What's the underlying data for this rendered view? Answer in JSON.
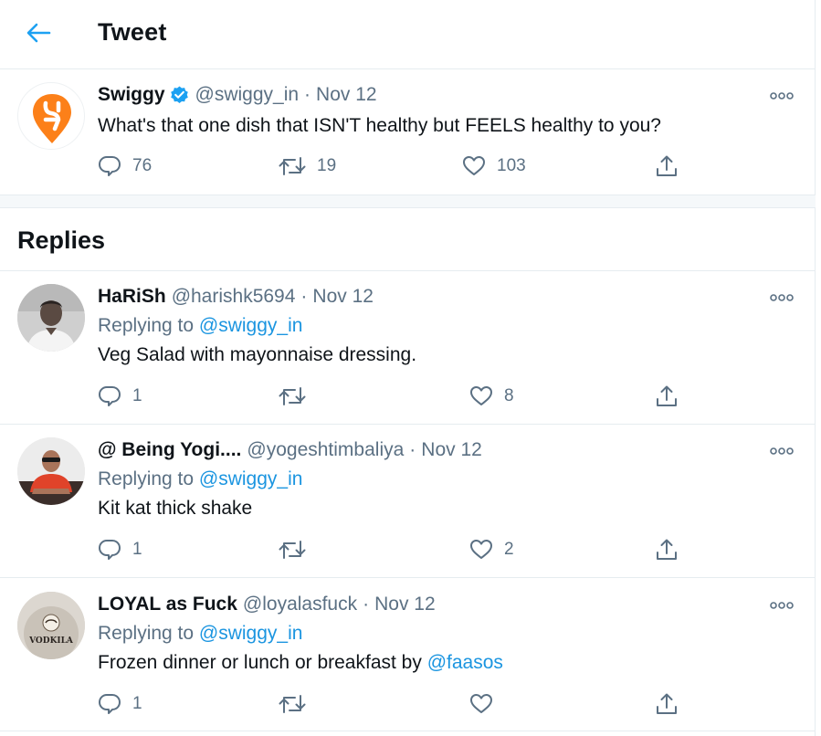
{
  "header": {
    "title": "Tweet",
    "back_icon": "arrow-left-icon"
  },
  "main_tweet": {
    "name": "Swiggy",
    "verified": true,
    "handle": "@swiggy_in",
    "separator": "·",
    "date": "Nov 12",
    "text": "What's that one dish that ISN'T healthy but FEELS healthy to you?",
    "replies": "76",
    "retweets": "19",
    "likes": "103",
    "brand_color": "#fc8019"
  },
  "replies_section": {
    "title": "Replies"
  },
  "replies": [
    {
      "name": "HaRiSh",
      "handle": "@harishk5694",
      "separator": "·",
      "date": "Nov 12",
      "replying_label": "Replying to",
      "replying_to": "@swiggy_in",
      "text": "Veg Salad with mayonnaise dressing.",
      "replies": "1",
      "retweets": "",
      "likes": "8"
    },
    {
      "name": "@ Being Yogi....",
      "handle": "@yogeshtimbaliya",
      "separator": "·",
      "date": "Nov 12",
      "replying_label": "Replying to",
      "replying_to": "@swiggy_in",
      "text": "Kit kat thick shake",
      "replies": "1",
      "retweets": "",
      "likes": "2"
    },
    {
      "name": "LOYAL as Fuck",
      "handle": "@loyalasfuck",
      "separator": "·",
      "date": "Nov 12",
      "replying_label": "Replying to",
      "replying_to": "@swiggy_in",
      "text_prefix": "Frozen dinner or lunch or breakfast by ",
      "text_mention": "@faasos",
      "replies": "1",
      "retweets": "",
      "likes": "",
      "avatar_text": "VODKILA"
    }
  ],
  "colors": {
    "accent": "#1da1f2",
    "link": "#1b95e0",
    "secondary_text": "#5b7083",
    "border": "#e6ecf0"
  }
}
